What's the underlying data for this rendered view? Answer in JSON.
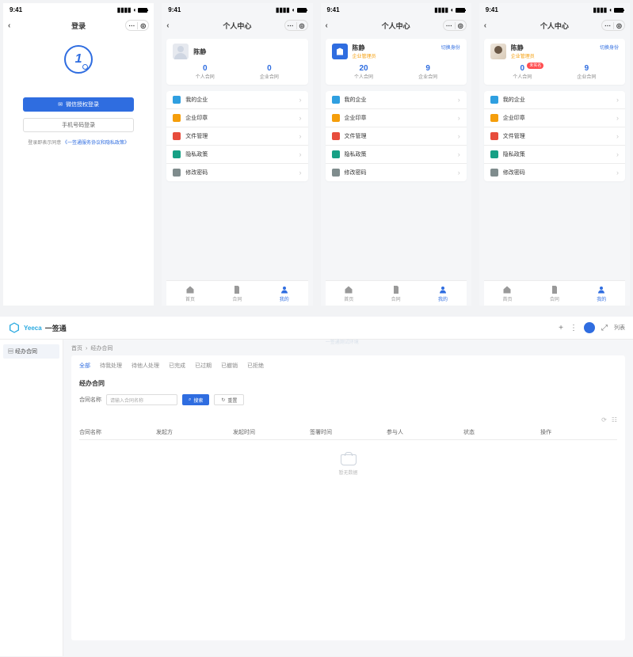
{
  "status_time": "9:41",
  "login": {
    "title": "登录",
    "wechat_btn": "微信授权登录",
    "phone_btn": "手机号码登录",
    "consent_prefix": "登录即表示同意",
    "consent_link": "《一签通服务协议和隐私政策》"
  },
  "profile_title": "个人中心",
  "switch_role": "切换身份",
  "stats_labels": {
    "personal": "个人合同",
    "company": "企业合同"
  },
  "menu": {
    "my_company": "我的企业",
    "company_seal": "企业印章",
    "files": "文件管理",
    "privacy": "隐私政策",
    "password": "修改密码"
  },
  "tabbar": {
    "home": "首页",
    "contract": "合同",
    "mine": "我的"
  },
  "screens": [
    {
      "name": "陈静",
      "sub": "",
      "personal": "0",
      "company": "0",
      "avatar": "person",
      "badge": null,
      "show_switch": false
    },
    {
      "name": "陈静",
      "sub": "企业管理员",
      "personal": "20",
      "company": "9",
      "avatar": "company",
      "badge": null,
      "show_switch": true
    },
    {
      "name": "陈静",
      "sub": "企业管理员",
      "personal": "0",
      "company": "9",
      "avatar": "photo",
      "badge": "未实名",
      "show_switch": true
    }
  ],
  "desktop": {
    "app_name": "一签通",
    "watermark": "一签通测试环境",
    "side_item": "经办合同",
    "crumb_root": "首页",
    "crumb_here": "经办合同",
    "tabs": [
      "全部",
      "待我处理",
      "待他人处理",
      "已完成",
      "已过期",
      "已撤销",
      "已拒绝"
    ],
    "section": "经办合同",
    "filter_label": "合同名称",
    "filter_placeholder": "请输入合同名称",
    "search": "搜索",
    "reset": "重置",
    "columns": [
      "合同名称",
      "发起方",
      "发起时间",
      "签署时间",
      "参与人",
      "状态",
      "操作"
    ],
    "empty": "暂无数据",
    "header_menu_label": "列表"
  }
}
